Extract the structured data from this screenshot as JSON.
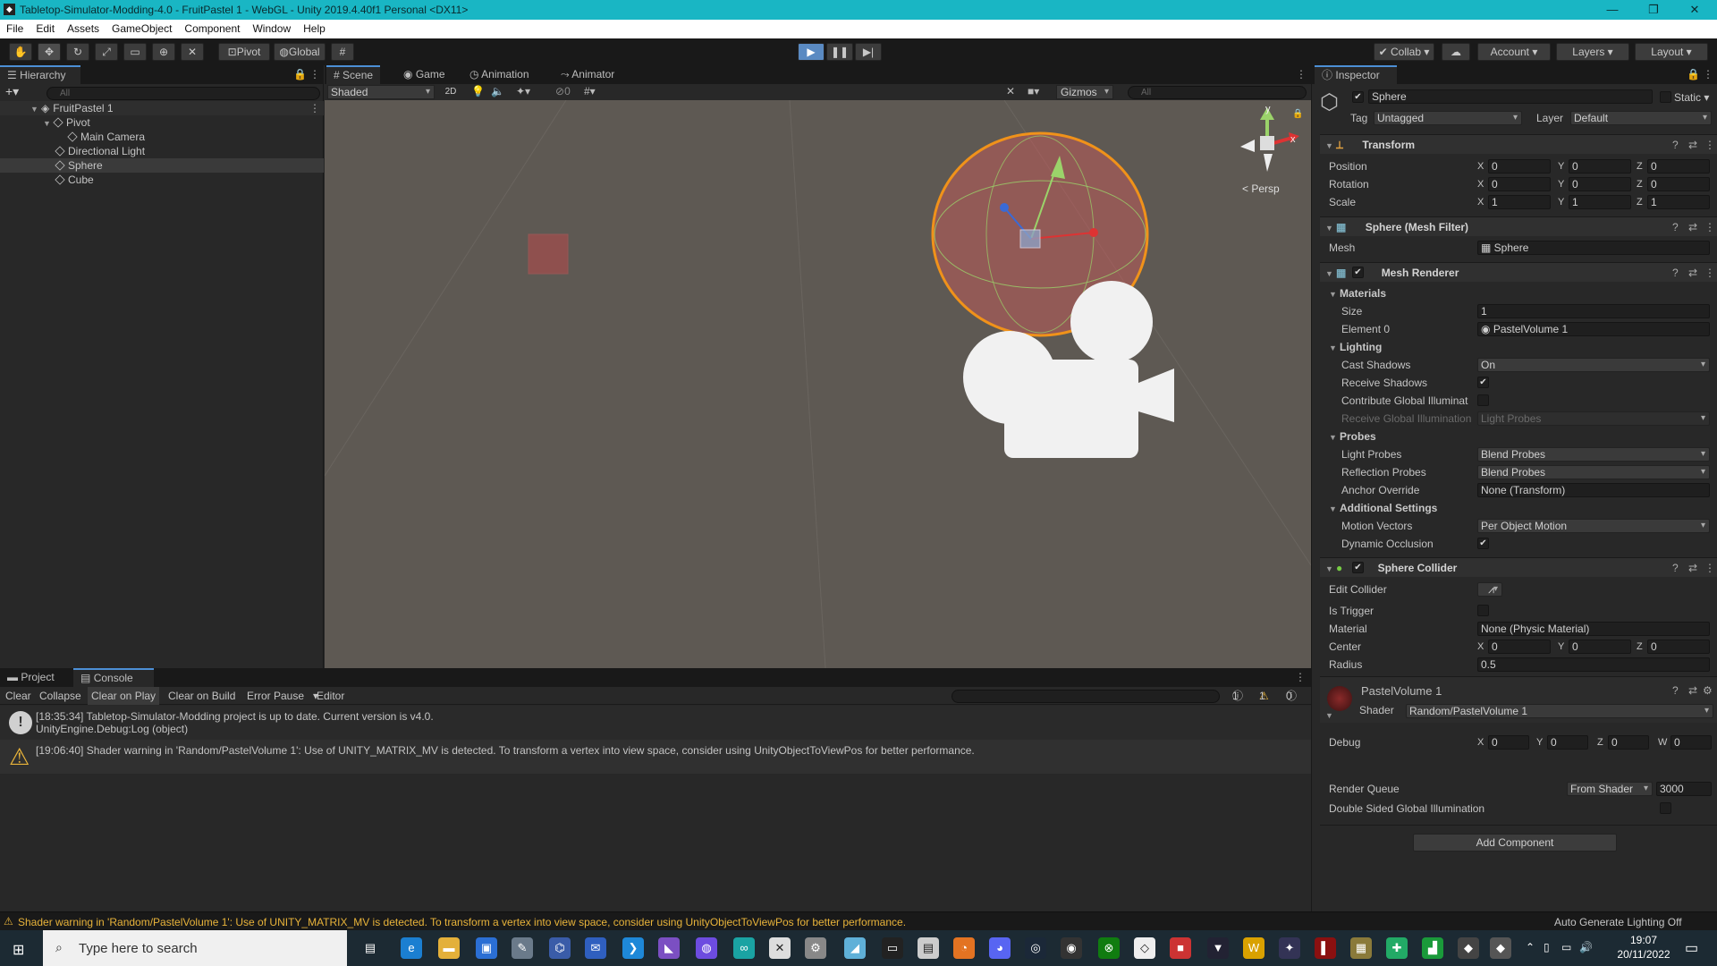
{
  "window": {
    "title": "Tabletop-Simulator-Modding-4.0 - FruitPastel 1 - WebGL - Unity 2019.4.40f1 Personal <DX11>",
    "app_icon": "unity-logo-icon",
    "controls": [
      "—",
      "❐",
      "✕"
    ]
  },
  "menu": [
    "File",
    "Edit",
    "Assets",
    "GameObject",
    "Component",
    "Window",
    "Help"
  ],
  "toolbar": {
    "pivot": "Pivot",
    "global": "Global",
    "collab": "Collab",
    "account": "Account",
    "layers": "Layers",
    "layout": "Layout"
  },
  "hierarchy": {
    "tab": "Hierarchy",
    "search_placeholder": "All",
    "items": [
      {
        "label": "FruitPastel 1",
        "level": 0
      },
      {
        "label": "Pivot",
        "level": 1
      },
      {
        "label": "Main Camera",
        "level": 2
      },
      {
        "label": "Directional Light",
        "level": 1
      },
      {
        "label": "Sphere",
        "level": 1,
        "selected": true
      },
      {
        "label": "Cube",
        "level": 1
      }
    ]
  },
  "scene": {
    "tabs": [
      "Scene",
      "Game",
      "Animation",
      "Animator"
    ],
    "shading": "Shaded",
    "mode_2d": "2D",
    "hidden_count": "0",
    "gizmos": "Gizmos",
    "search_placeholder": "All",
    "persp": "< Persp",
    "axis_y": "y",
    "axis_x": "x"
  },
  "inspector": {
    "tab": "Inspector",
    "object_name": "Sphere",
    "static_label": "Static",
    "tag_label": "Tag",
    "tag_value": "Untagged",
    "layer_label": "Layer",
    "layer_value": "Default",
    "transform": {
      "title": "Transform",
      "position_label": "Position",
      "rotation_label": "Rotation",
      "scale_label": "Scale",
      "position": [
        "0",
        "0",
        "0"
      ],
      "rotation": [
        "0",
        "0",
        "0"
      ],
      "scale": [
        "1",
        "1",
        "1"
      ]
    },
    "mesh_filter": {
      "title": "Sphere (Mesh Filter)",
      "mesh_label": "Mesh",
      "mesh_value": "Sphere"
    },
    "mesh_renderer": {
      "title": "Mesh Renderer",
      "materials": "Materials",
      "size_label": "Size",
      "size_value": "1",
      "element0_label": "Element 0",
      "element0_value": "PastelVolume 1",
      "lighting": "Lighting",
      "cast_shadows_label": "Cast Shadows",
      "cast_shadows_value": "On",
      "receive_shadows_label": "Receive Shadows",
      "contribute_gi_label": "Contribute Global Illuminat",
      "receive_gi_label": "Receive Global Illumination",
      "receive_gi_value": "Light Probes",
      "probes": "Probes",
      "light_probes_label": "Light Probes",
      "light_probes_value": "Blend Probes",
      "reflection_probes_label": "Reflection Probes",
      "reflection_probes_value": "Blend Probes",
      "anchor_override_label": "Anchor Override",
      "anchor_override_value": "None (Transform)",
      "additional": "Additional Settings",
      "motion_vectors_label": "Motion Vectors",
      "motion_vectors_value": "Per Object Motion",
      "dynamic_occlusion_label": "Dynamic Occlusion"
    },
    "sphere_collider": {
      "title": "Sphere Collider",
      "edit_collider_label": "Edit Collider",
      "is_trigger_label": "Is Trigger",
      "material_label": "Material",
      "material_value": "None (Physic Material)",
      "center_label": "Center",
      "center": [
        "0",
        "0",
        "0"
      ],
      "radius_label": "Radius",
      "radius_value": "0.5"
    },
    "material": {
      "name": "PastelVolume 1",
      "shader_label": "Shader",
      "shader_value": "Random/PastelVolume 1",
      "debug_label": "Debug",
      "debug": [
        "0",
        "0",
        "0",
        "0"
      ],
      "render_queue_label": "Render Queue",
      "render_queue_mode": "From Shader",
      "render_queue_value": "3000",
      "double_sided_label": "Double Sided Global Illumination"
    },
    "add_component": "Add Component"
  },
  "console": {
    "tabs": [
      "Project",
      "Console"
    ],
    "buttons": [
      "Clear",
      "Collapse",
      "Clear on Play",
      "Clear on Build",
      "Error Pause",
      "Editor"
    ],
    "counts": {
      "info": "1",
      "warning": "1",
      "error": "0"
    },
    "messages": [
      {
        "type": "info",
        "line1": "[18:35:34] Tabletop-Simulator-Modding project is up to date. Current version is v4.0.",
        "line2": "UnityEngine.Debug:Log (object)"
      },
      {
        "type": "warning",
        "line1": "[19:06:40] Shader warning in 'Random/PastelVolume 1': Use of UNITY_MATRIX_MV is detected. To transform a vertex into view space, consider using UnityObjectToViewPos for better performance.",
        "line2": ""
      }
    ]
  },
  "statusbar": {
    "message": "Shader warning in 'Random/PastelVolume 1': Use of UNITY_MATRIX_MV is detected. To transform a vertex into view space, consider using UnityObjectToViewPos for better performance.",
    "right": "Auto Generate Lighting Off"
  },
  "taskbar": {
    "search_placeholder": "Type here to search",
    "time": "19:07",
    "date": "20/11/2022"
  },
  "colors": {
    "titlebar": "#19b6c4",
    "scene_bg": "#5e5953",
    "selection_outline": "#f0921a",
    "play_active": "#5a8ac2"
  }
}
